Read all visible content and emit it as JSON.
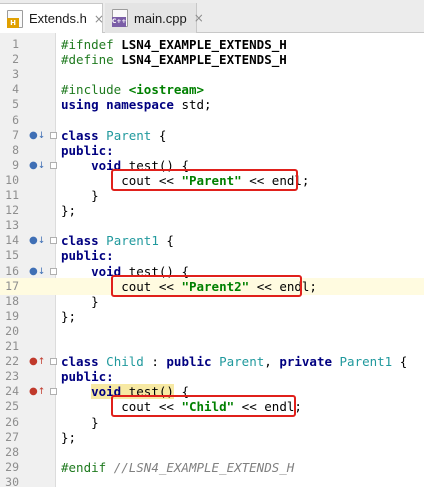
{
  "tabs": [
    {
      "label": "Extends.h",
      "icon": "header-file-icon",
      "badge": "H",
      "active": true
    },
    {
      "label": "main.cpp",
      "icon": "cpp-file-icon",
      "badge": "C++",
      "active": false
    }
  ],
  "close_glyph": "×",
  "line_numbers": [
    "1",
    "2",
    "3",
    "4",
    "5",
    "6",
    "7",
    "8",
    "9",
    "10",
    "11",
    "12",
    "13",
    "14",
    "15",
    "16",
    "17",
    "18",
    "19",
    "20",
    "21",
    "22",
    "23",
    "24",
    "25",
    "26",
    "27",
    "28",
    "29",
    "30"
  ],
  "code": {
    "l1_kw": "#ifndef",
    "l1_name": "LSN4_EXAMPLE_EXTENDS_H",
    "l2_kw": "#define",
    "l2_name": "LSN4_EXAMPLE_EXTENDS_H",
    "l4_kw": "#include",
    "l4_hdr": "<iostream>",
    "l5_using": "using",
    "l5_ns": "namespace",
    "l5_rest": "std;",
    "class_kw": "class",
    "public_kw": "public:",
    "void_kw": "void",
    "parent": "Parent",
    "parent1": "Parent1",
    "child": "Child",
    "open_brace": "{",
    "close_brace": "}",
    "close_semi": "};",
    "test_sig": "test()",
    "cout": "cout",
    "shl": "<<",
    "endl": "endl;",
    "str_parent": "\"Parent\"",
    "str_parent2": "\"Parent2\"",
    "str_child": "\"Child\"",
    "child_colon": ":",
    "public_inh": "public",
    "comma": ",",
    "private_inh": "private",
    "endif_kw": "#endif",
    "endif_cmt": "//LSN4_EXAMPLE_EXTENDS_H"
  },
  "highlighted_line": "17",
  "colors": {
    "keyword": "#000080",
    "string": "#008000",
    "class_name": "#20999d",
    "comment": "#808080",
    "highlight_box": "#e0201b"
  }
}
